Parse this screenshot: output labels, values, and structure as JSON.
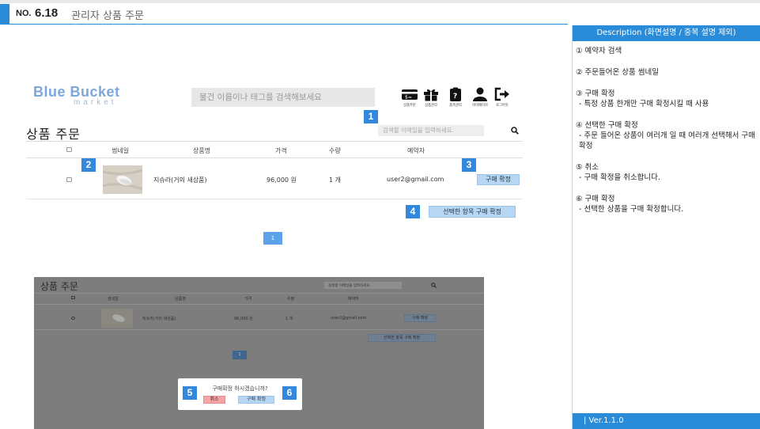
{
  "header": {
    "no_label": "NO.",
    "number": "6.18",
    "title": "관리자 상품 주문"
  },
  "description": {
    "title": "Description (화면설명 / 중복 설명 제외)",
    "items": [
      {
        "title": "① 예약자 검색",
        "detail": ""
      },
      {
        "title": "② 주문들어온 상품 썸네일",
        "detail": ""
      },
      {
        "title": "③ 구매 확정",
        "detail": "- 특정 상품 한개만 구매 확정시킬 때 사용"
      },
      {
        "title": "④ 선택한 구매 확정",
        "detail": "- 주문 들어온 상품이 여러개 일 때 여러개 선택해서 구매 확정"
      },
      {
        "title": "⑤ 취소",
        "detail": "- 구매 확정을 취소합니다."
      },
      {
        "title": "⑥ 구매 확정",
        "detail": "- 선택한 상품을 구매 확정합니다."
      }
    ],
    "footer": "| Ver.1.1.0"
  },
  "mockup": {
    "logo_main": "Blue Bucket",
    "logo_sub": "market",
    "search_placeholder": "물건 이름이나 태그를 검색해보세요",
    "nav": [
      {
        "label": "상품주문",
        "icon": "card-icon"
      },
      {
        "label": "상품관리",
        "icon": "gift-icon"
      },
      {
        "label": "품목관리",
        "icon": "clipboard-question-icon"
      },
      {
        "label": "마이페이지",
        "icon": "user-icon"
      },
      {
        "label": "로그아웃",
        "icon": "logout-icon"
      }
    ],
    "page_title": "상품 주문",
    "email_search_placeholder": "검색할 이메일을 입력하세요.",
    "columns": [
      "썸네일",
      "상품명",
      "가격",
      "수량",
      "예약자"
    ],
    "row": {
      "product": "지슈라(거의 새상품)",
      "price": "96,000 원",
      "quantity": "1 개",
      "reserver": "user2@gmail.com",
      "confirm_label": "구매 확정"
    },
    "confirm_selected_label": "선택한 항목 구매 확정",
    "page_number": "1"
  },
  "modal": {
    "message": "구매확정 하시겠습니까?",
    "cancel_label": "취소",
    "confirm_label": "구매 확정"
  },
  "badges": [
    "1",
    "2",
    "3",
    "4",
    "5",
    "6"
  ],
  "colors": {
    "accent": "#2a8bd8",
    "badge": "#3388dd",
    "confirm_button": "#b7d6f3",
    "cancel_button": "#f4a6a6"
  }
}
